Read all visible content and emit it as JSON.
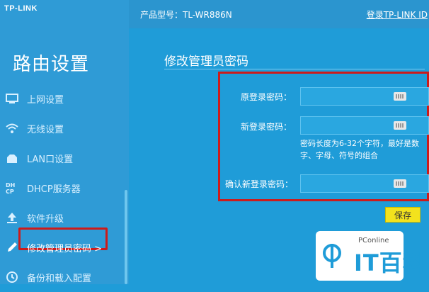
{
  "brand": {
    "logo_text": "TP-LINK"
  },
  "sidebar": {
    "title": "路由设置",
    "items": [
      {
        "label": "上网设置",
        "icon": "monitor-icon"
      },
      {
        "label": "无线设置",
        "icon": "wifi-icon"
      },
      {
        "label": "LAN口设置",
        "icon": "lan-icon"
      },
      {
        "label": "DHCP服务器",
        "icon": "dhcp-icon"
      },
      {
        "label": "软件升级",
        "icon": "upload-arrow-icon"
      },
      {
        "label": "修改管理员密码 >",
        "icon": "pencil-icon",
        "active": true
      },
      {
        "label": "备份和载入配置",
        "icon": "backup-clock-icon"
      }
    ]
  },
  "topbar": {
    "model": "产品型号：TL-WR886N",
    "login_link": "登录TP-LINK ID"
  },
  "main": {
    "title": "修改管理员密码",
    "fields": {
      "old_label": "原登录密码：",
      "new_label": "新登录密码：",
      "confirm_label": "确认新登录密码："
    },
    "hint": "密码长度为6-32个字符，最好是数字、字母、符号的组合",
    "save_label": "保存"
  },
  "watermark": {
    "small": "PConline",
    "big": "IT百科"
  },
  "colors": {
    "primary": "#1f9cd8",
    "highlight": "#cc1b1b",
    "save": "#f3e21d"
  }
}
